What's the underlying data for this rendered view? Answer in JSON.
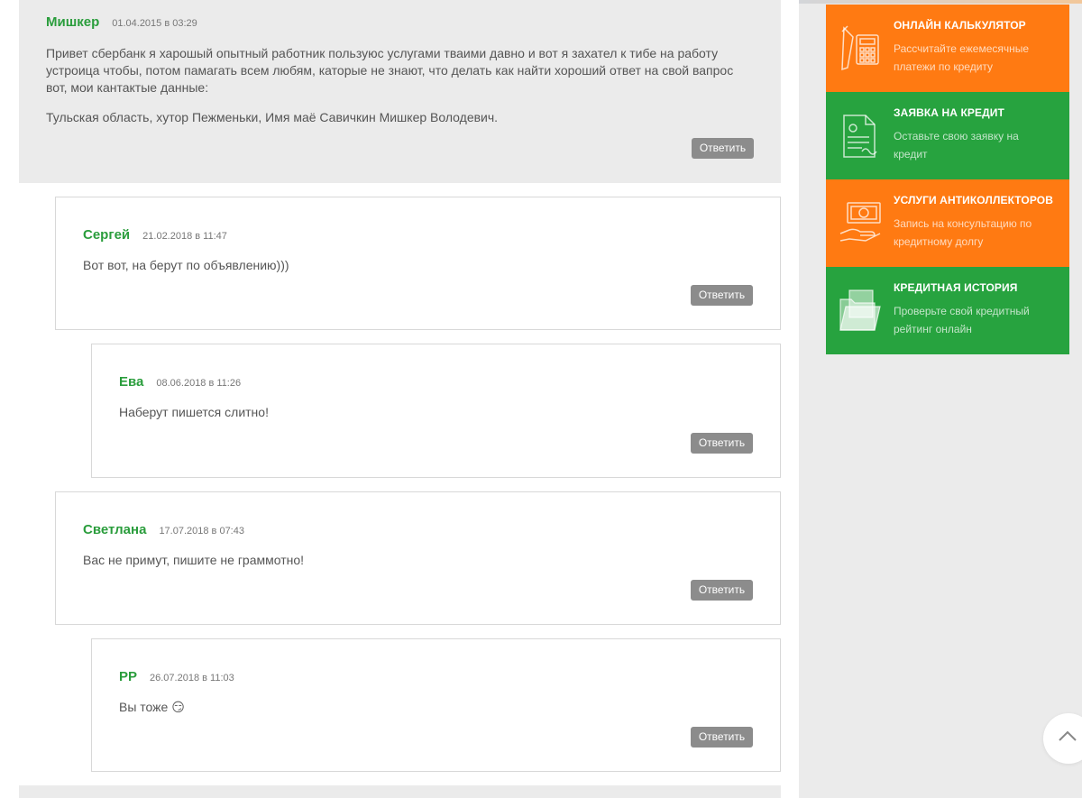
{
  "comments": [
    {
      "author": "Мишкер",
      "date": "01.04.2015 в 03:29",
      "text_lines": [
        "Привет сбербанк я харошый опытный работник пользуюс услугами тваими давно и вот я захател к тибе на работу",
        "устроица чтобы, потом памагать всем любям, каторые не знают, что делать как найти хороший ответ на свой вапрос",
        "вот, мои кантактые данные:"
      ],
      "text_line2": "Тульская область, хутор Пежменьки, Имя маё Савичкин Мишкер Володевич.",
      "reply_label": "Ответить"
    },
    {
      "author": "Сергей",
      "date": "21.02.2018 в 11:47",
      "text": "Вот вот, на берут по объявлению)))",
      "reply_label": "Ответить"
    },
    {
      "author": "Ева",
      "date": "08.06.2018 в 11:26",
      "text": "Наберут пишется слитно!",
      "reply_label": "Ответить"
    },
    {
      "author": "Светлана",
      "date": "17.07.2018 в 07:43",
      "text": "Вас не примут, пишите не граммотно!",
      "reply_label": "Ответить"
    },
    {
      "author": "РР",
      "date": "26.07.2018 в 11:03",
      "text": "Вы тоже",
      "emoji": "😏",
      "reply_label": "Ответить"
    }
  ],
  "sidebar": [
    {
      "title": "ОНЛАЙН КАЛЬКУЛЯТОР",
      "desc_lines": [
        "Рассчитайте ежемесячные",
        "платежи по кредиту"
      ],
      "color": "#ff7a12",
      "icon": "calculator-icon"
    },
    {
      "title": "ЗАЯВКА НА КРЕДИТ",
      "desc_lines": [
        "Оставьте свою заявку на",
        "кредит"
      ],
      "color": "#27a33f",
      "icon": "document-icon"
    },
    {
      "title": "УСЛУГИ АНТИКОЛЛЕКТОРОВ",
      "desc_lines": [
        "Запись на консультацию по",
        "кредитному долгу"
      ],
      "color": "#ff7a12",
      "icon": "money-hand-icon"
    },
    {
      "title": "КРЕДИТНАЯ ИСТОРИЯ",
      "desc_lines": [
        "Проверьте свой кредитный",
        "рейтинг онлайн"
      ],
      "color": "#27a33f",
      "icon": "folder-icon"
    }
  ],
  "colors": {
    "author": "#2a9d3c",
    "reply_button": "#8c8c8c",
    "orange": "#ff7a12",
    "green": "#27a33f"
  }
}
